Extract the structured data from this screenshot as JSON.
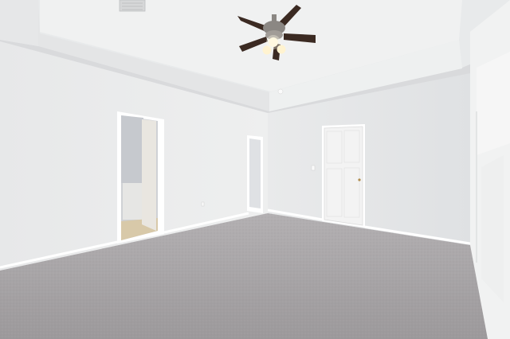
{
  "scene": {
    "description_free": true
  },
  "palette": {
    "ceiling": "#eceeef",
    "tray_face": "#f1f2f2",
    "wall_left": "#e9eaeb",
    "wall_back": "#e4e6e8",
    "wall_right": "#eff0f0",
    "carpet": "#a6a3a5",
    "door": "#f4f4f4",
    "fan_blade": "#3b2a22",
    "fan_metal": "#8b8783",
    "light": "#fff6dc"
  },
  "icons": {
    "fan": "ceiling-fan-icon",
    "vent": "air-vent-icon"
  }
}
